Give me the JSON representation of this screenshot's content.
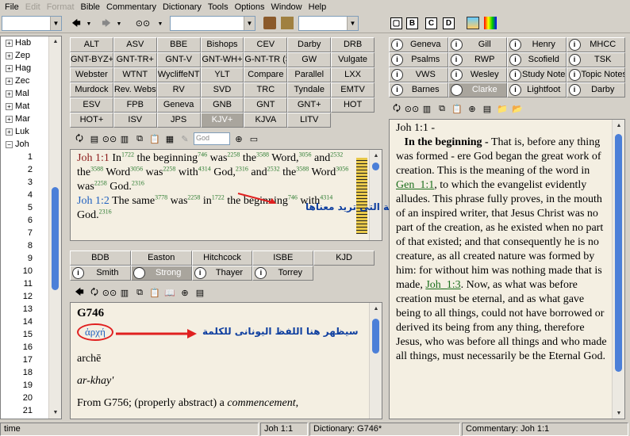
{
  "menu": [
    "File",
    "Edit",
    "Format",
    "Bible",
    "Commentary",
    "Dictionary",
    "Tools",
    "Options",
    "Window",
    "Help"
  ],
  "menu_disabled": [
    "Edit",
    "Format"
  ],
  "toolbar_icons": [
    "back-arrow-icon",
    "forward-arrow-icon",
    "binoculars-icon",
    "book-icon",
    "library-icon",
    "tile-icon-a",
    "tile-icon-b",
    "tile-icon-c",
    "tile-icon-d",
    "picture-icon",
    "colors-icon"
  ],
  "tree": {
    "books": [
      "Hab",
      "Zep",
      "Hag",
      "Zec",
      "Mal",
      "Mat",
      "Mar",
      "Luk",
      "Joh"
    ],
    "expanded": "Joh",
    "chapters": [
      "1",
      "2",
      "3",
      "4",
      "5",
      "6",
      "7",
      "8",
      "9",
      "10",
      "11",
      "12",
      "13",
      "14",
      "15",
      "16",
      "17",
      "18",
      "19",
      "20",
      "21"
    ]
  },
  "bible_tabs": [
    "ALT",
    "ASV",
    "BBE",
    "Bishops",
    "CEV",
    "Darby",
    "DRB",
    "GNT-BYZ+",
    "GNT-TR+",
    "GNT-V",
    "GNT-WH+",
    "G-NT-TR (Steph)+",
    "GW",
    "Vulgate",
    "Webster",
    "WTNT",
    "WycliffeNT",
    "YLT",
    "Compare",
    "Parallel",
    "LXX",
    "Murdock",
    "Rev. Webster+",
    "RV",
    "SVD",
    "TRC",
    "Tyndale",
    "EMTV",
    "ESV",
    "FPB",
    "Geneva",
    "GNB",
    "GNT",
    "GNT+",
    "HOT",
    "HOT+",
    "ISV",
    "JPS",
    "KJV+",
    "KJVA",
    "LITV"
  ],
  "bible_selected": "KJV+",
  "bible_text": {
    "v1_ref": "Joh 1:1",
    "v1": [
      [
        "In",
        "1722"
      ],
      [
        "the beginning",
        "746"
      ],
      [
        "was",
        "2258"
      ],
      [
        "the",
        "3588"
      ],
      [
        "Word,",
        "3056"
      ],
      [
        "and",
        "2532"
      ],
      [
        "the",
        "3588"
      ],
      [
        "Word",
        "3056"
      ],
      [
        "was",
        "2258"
      ],
      [
        "with",
        "4314"
      ],
      [
        "God,",
        "2316"
      ],
      [
        "and",
        "2532"
      ],
      [
        "the",
        "3588"
      ],
      [
        "Word",
        "3056"
      ],
      [
        "was",
        "2258"
      ],
      [
        "God.",
        "2316"
      ]
    ],
    "v2_ref": "Joh 1:2",
    "v2": [
      [
        "The same",
        "3778"
      ],
      [
        "was",
        "2258"
      ],
      [
        "in",
        "1722"
      ],
      [
        "the",
        ""
      ],
      [
        "beginning",
        "746"
      ],
      [
        "with",
        "4314"
      ],
      [
        "God.",
        "2316"
      ]
    ]
  },
  "annotation_bible": "اضغط على الرقم الذى بجوار الكلمة التى تريد معناها",
  "commentary_tabs": [
    "Geneva",
    "Gill",
    "Henry",
    "MHCC",
    "Psalms",
    "RWP",
    "Scofield",
    "TSK",
    "VWS",
    "Wesley",
    "Study Notes",
    "Topic Notes",
    "Barnes",
    "Clarke",
    "Lightfoot",
    "Darby"
  ],
  "commentary_selected": "Clarke",
  "commentary_text": {
    "ref": "Joh 1:1 -",
    "heading": "In the beginning -",
    "body1": "That is, before any thing was formed - ere God began the great work of creation. This is the meaning of the word in ",
    "link1": "Gen_1:1",
    "body2": ", to which the evangelist evidently alludes. This phrase fully proves, in the mouth of an inspired writer, that Jesus Christ was no part of the creation, as he existed when no part of that existed; and that consequently he is no creature, as all created nature was formed by him: for without him was nothing made that is made, ",
    "link2": "Joh_1:3",
    "body3": ". Now, as what was before creation must be eternal, and as what gave being to all things, could not have borrowed or derived its being from any thing, therefore Jesus, who was before all things and who made all things, must necessarily be the Eternal God."
  },
  "dictionary_tabs": [
    "BDB",
    "Easton",
    "Hitchcock",
    "ISBE",
    "KJD",
    "Smith",
    "Strong",
    "Thayer",
    "Torrey"
  ],
  "dictionary_selected": "Strong",
  "dictionary_text": {
    "entry": "G746",
    "greek": "ἀρχή",
    "translit": "archē",
    "pron": "ar-khay'",
    "def_start": "From G756; (properly abstract) a ",
    "def_em": "commencement",
    "def_end": ","
  },
  "annotation_dict": "سيظهر هنا اللفظ اليونانى للكلمة",
  "verse_combo": "God",
  "status": {
    "hint": "time",
    "verse": "Joh 1:1",
    "dictionary": "Dictionary: G746*",
    "commentary": "Commentary: Joh 1:1"
  }
}
